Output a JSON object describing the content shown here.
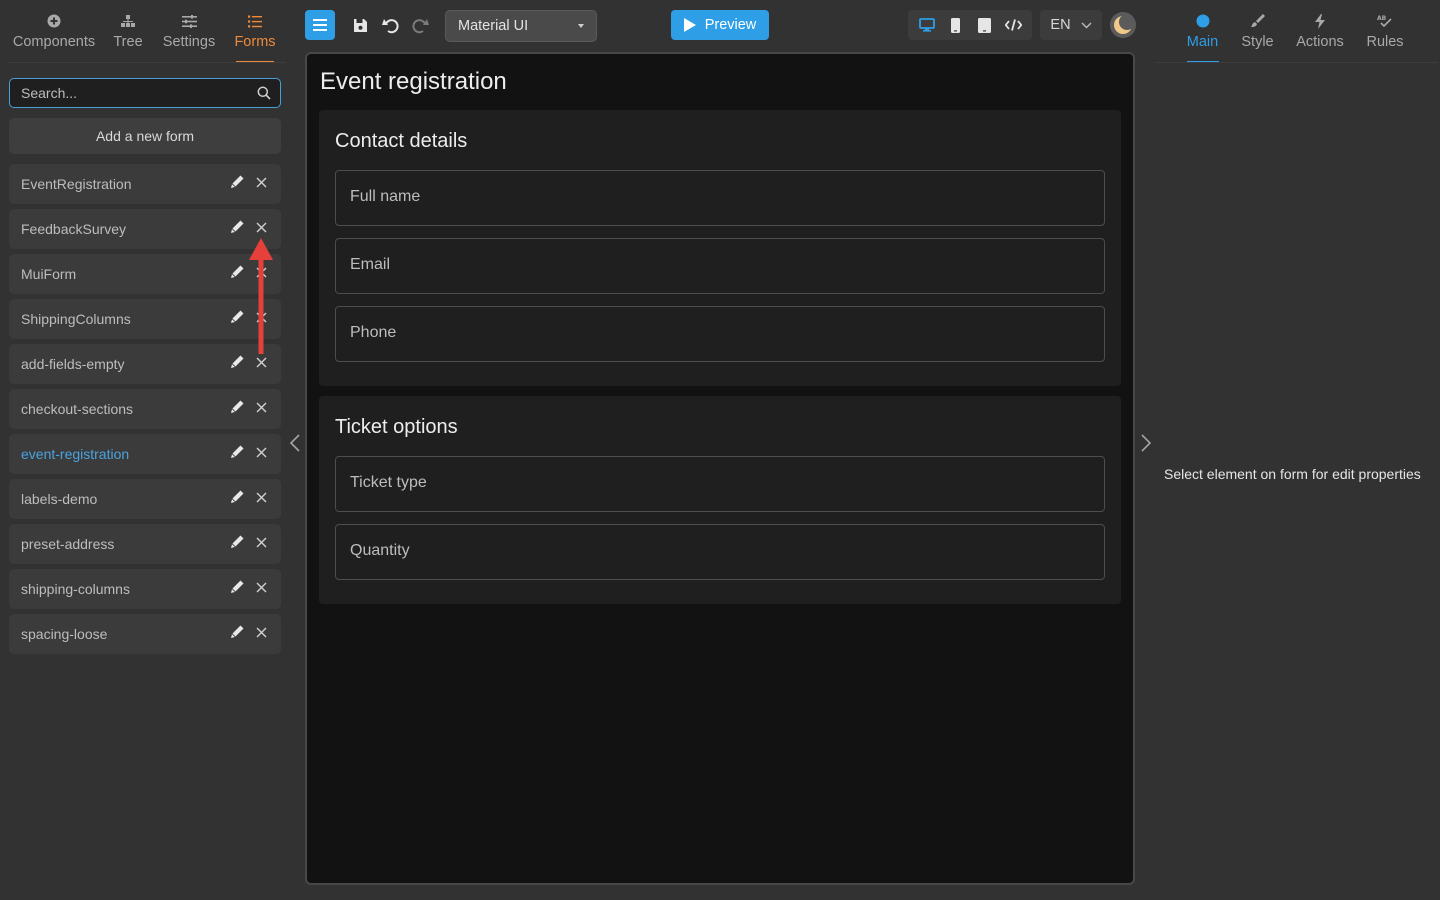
{
  "left_tabs": [
    {
      "label": "Components",
      "icon": "plus-circle-icon"
    },
    {
      "label": "Tree",
      "icon": "tree-icon"
    },
    {
      "label": "Settings",
      "icon": "sliders-icon"
    },
    {
      "label": "Forms",
      "icon": "list-icon",
      "active": true
    }
  ],
  "search": {
    "placeholder": "Search...",
    "value": ""
  },
  "add_form_label": "Add a new form",
  "forms": [
    {
      "name": "EventRegistration"
    },
    {
      "name": "FeedbackSurvey"
    },
    {
      "name": "MuiForm"
    },
    {
      "name": "ShippingColumns"
    },
    {
      "name": "add-fields-empty"
    },
    {
      "name": "checkout-sections"
    },
    {
      "name": "event-registration",
      "active": true
    },
    {
      "name": "labels-demo"
    },
    {
      "name": "preset-address"
    },
    {
      "name": "shipping-columns"
    },
    {
      "name": "spacing-loose"
    }
  ],
  "toolbar": {
    "library": "Material UI",
    "preview_label": "Preview",
    "language": "EN",
    "icons": [
      "menu-icon",
      "save-icon",
      "undo-icon",
      "redo-icon",
      "desktop-icon",
      "mobile-icon",
      "tablet-icon",
      "code-icon",
      "moon-icon"
    ]
  },
  "canvas": {
    "title": "Event registration",
    "sections": [
      {
        "title": "Contact details",
        "fields": [
          "Full name",
          "Email",
          "Phone"
        ]
      },
      {
        "title": "Ticket options",
        "fields": [
          "Ticket type",
          "Quantity"
        ]
      }
    ]
  },
  "right_tabs": [
    {
      "label": "Main",
      "icon": "dot-icon",
      "active": true
    },
    {
      "label": "Style",
      "icon": "brush-icon"
    },
    {
      "label": "Actions",
      "icon": "lightning-icon"
    },
    {
      "label": "Rules",
      "icon": "rules-icon"
    }
  ],
  "properties_hint": "Select element on form for edit properties",
  "colors": {
    "accent_blue": "#2e9ee6",
    "accent_orange": "#ee8a3a",
    "annotation_red": "#e5403a",
    "background": "#323232",
    "canvas_background": "#121212"
  }
}
